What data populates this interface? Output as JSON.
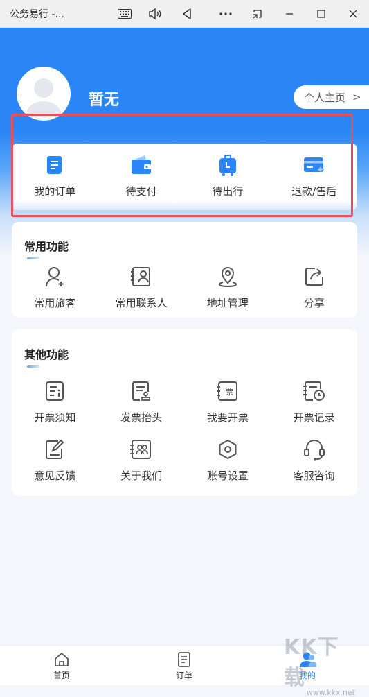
{
  "window": {
    "title": "公务易行 -..."
  },
  "profile": {
    "name": "暂无",
    "homepage_label": "个人主页",
    "homepage_chevron": ">"
  },
  "orders": {
    "items": [
      {
        "label": "我的订单",
        "icon": "order-doc-icon"
      },
      {
        "label": "待支付",
        "icon": "wallet-icon"
      },
      {
        "label": "待出行",
        "icon": "luggage-icon"
      },
      {
        "label": "退款/售后",
        "icon": "refund-card-icon"
      }
    ]
  },
  "common": {
    "title": "常用功能",
    "items": [
      {
        "label": "常用旅客",
        "icon": "traveler-icon"
      },
      {
        "label": "常用联系人",
        "icon": "contacts-icon"
      },
      {
        "label": "地址管理",
        "icon": "location-pin-icon"
      },
      {
        "label": "分享",
        "icon": "share-icon"
      }
    ]
  },
  "other": {
    "title": "其他功能",
    "items": [
      {
        "label": "开票须知",
        "icon": "invoice-info-icon"
      },
      {
        "label": "发票抬头",
        "icon": "invoice-title-icon"
      },
      {
        "label": "我要开票",
        "icon": "invoice-issue-icon"
      },
      {
        "label": "开票记录",
        "icon": "invoice-record-icon"
      },
      {
        "label": "意见反馈",
        "icon": "feedback-icon"
      },
      {
        "label": "关于我们",
        "icon": "about-icon"
      },
      {
        "label": "账号设置",
        "icon": "settings-hex-icon"
      },
      {
        "label": "客服咨询",
        "icon": "headset-icon"
      }
    ]
  },
  "tabbar": {
    "items": [
      {
        "label": "首页",
        "icon": "home-icon"
      },
      {
        "label": "订单",
        "icon": "order-list-icon"
      },
      {
        "label": "我的",
        "icon": "user-profile-icon"
      }
    ],
    "active": "我的"
  },
  "watermark": {
    "logo": "KK下载",
    "url": "www.kkx.net"
  },
  "colors": {
    "primary": "#2a86f6",
    "highlight_border": "#e8505b",
    "icon_gray": "#555555"
  }
}
